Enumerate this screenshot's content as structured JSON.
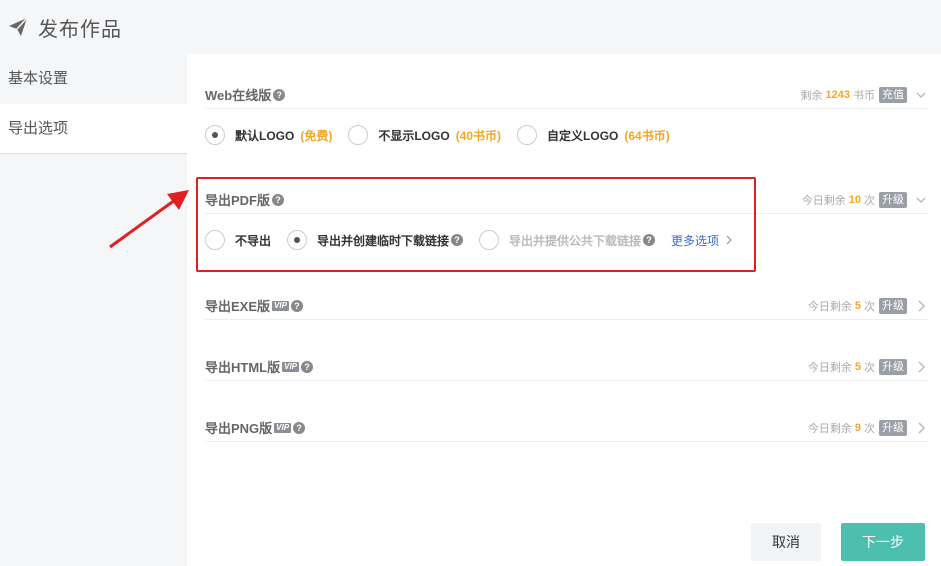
{
  "header": {
    "title": "发布作品",
    "icon": "paper-plane-icon"
  },
  "sidebar": {
    "items": [
      {
        "label": "基本设置",
        "active": false
      },
      {
        "label": "导出选项",
        "active": true
      }
    ]
  },
  "web": {
    "title": "Web在线版",
    "remain_prefix": "剩余",
    "remain_num": "1243",
    "remain_unit": "书币",
    "badge": "充值",
    "options": [
      {
        "label": "默认LOGO",
        "tag": "(免费)",
        "checked": true
      },
      {
        "label": "不显示LOGO",
        "tag": "(40书币)",
        "checked": false
      },
      {
        "label": "自定义LOGO",
        "tag": "(64书币)",
        "checked": false
      }
    ]
  },
  "pdf": {
    "title": "导出PDF版",
    "remain_prefix": "今日剩余",
    "remain_num": "10",
    "remain_unit": "次",
    "badge": "升级",
    "options": [
      {
        "label": "不导出",
        "checked": false
      },
      {
        "label": "导出并创建临时下载链接",
        "checked": true
      },
      {
        "label": "导出并提供公共下载链接",
        "checked": false,
        "disabled": true
      }
    ],
    "more": "更多选项"
  },
  "exe": {
    "title": "导出EXE版",
    "vip": "VIP",
    "remain_prefix": "今日剩余",
    "remain_num": "5",
    "remain_unit": "次",
    "badge": "升级"
  },
  "html": {
    "title": "导出HTML版",
    "vip": "VIP",
    "remain_prefix": "今日剩余",
    "remain_num": "5",
    "remain_unit": "次",
    "badge": "升级"
  },
  "png": {
    "title": "导出PNG版",
    "vip": "VIP",
    "remain_prefix": "今日剩余",
    "remain_num": "9",
    "remain_unit": "次",
    "badge": "升级"
  },
  "footer": {
    "cancel": "取消",
    "next": "下一步"
  },
  "colors": {
    "accent": "#4dbfb0",
    "highlight": "#f5a623",
    "annotation": "#e02020",
    "link": "#3a6fc4"
  }
}
